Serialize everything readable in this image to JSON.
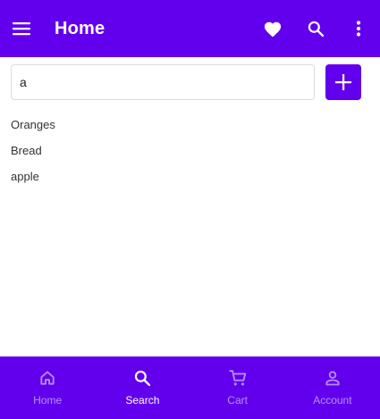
{
  "app_bar": {
    "title": "Home",
    "menu_icon": "menu-icon",
    "actions": [
      "heart-icon",
      "search-icon",
      "more-vert-icon"
    ]
  },
  "search": {
    "value": "a",
    "add_icon": "plus-icon"
  },
  "list": {
    "items": [
      "Oranges",
      "Bread",
      "apple"
    ]
  },
  "bottom_nav": {
    "items": [
      {
        "label": "Home",
        "icon": "home-icon",
        "active": false
      },
      {
        "label": "Search",
        "icon": "search-icon",
        "active": true
      },
      {
        "label": "Cart",
        "icon": "cart-icon",
        "active": false
      },
      {
        "label": "Account",
        "icon": "account-icon",
        "active": false
      }
    ]
  },
  "colors": {
    "primary": "#6200ee",
    "on_primary": "#ffffff",
    "inactive_nav": "rgba(255,255,255,0.55)",
    "text": "#333333",
    "input_border": "#dcdcdc"
  }
}
